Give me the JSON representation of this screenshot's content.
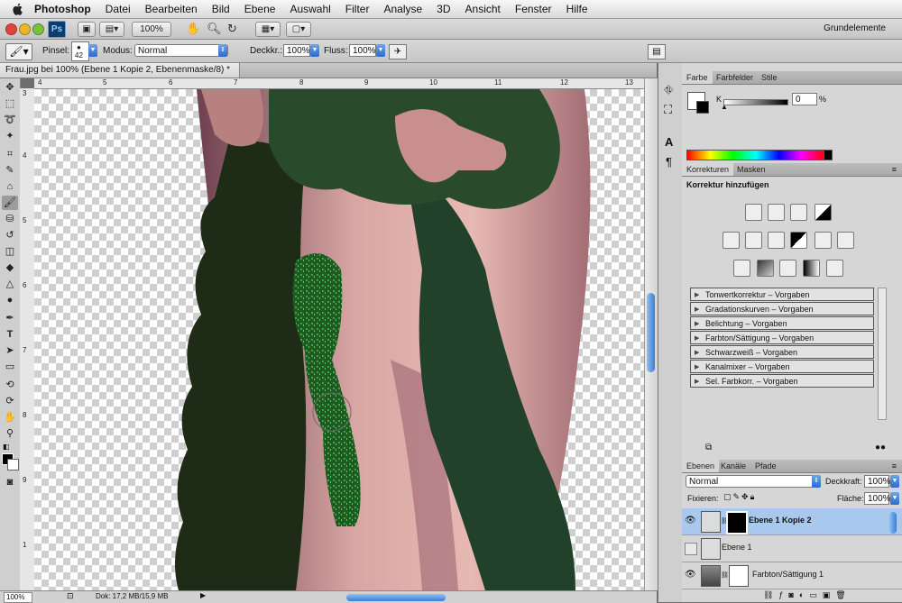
{
  "menubar": {
    "app": "Photoshop",
    "items": [
      "Datei",
      "Bearbeiten",
      "Bild",
      "Ebene",
      "Auswahl",
      "Filter",
      "Analyse",
      "3D",
      "Ansicht",
      "Fenster",
      "Hilfe"
    ]
  },
  "appbar": {
    "ps": "Ps",
    "zoom": "100%",
    "workspace": "Grundelemente"
  },
  "options": {
    "brush_label": "Pinsel:",
    "brush_size": "42",
    "mode_label": "Modus:",
    "mode_value": "Normal",
    "opacity_label": "Deckkr.:",
    "opacity_value": "100%",
    "flow_label": "Fluss:",
    "flow_value": "100%"
  },
  "document": {
    "tab_title": "Frau.jpg bei 100% (Ebene 1 Kopie 2, Ebenenmaske/8) *"
  },
  "ruler": {
    "top": [
      "4",
      "5",
      "6",
      "7",
      "8",
      "9",
      "10",
      "11",
      "12",
      "13"
    ],
    "left": [
      "3",
      "4",
      "5",
      "6",
      "7",
      "8",
      "9",
      "1"
    ]
  },
  "status": {
    "zoom": "100%",
    "doc": "Dok: 17,2 MB/15,9 MB"
  },
  "color_panel": {
    "tabs": [
      "Farbe",
      "Farbfelder",
      "Stile"
    ],
    "k_label": "K",
    "k_value": "0",
    "percent": "%"
  },
  "adjust_panel": {
    "tabs": [
      "Korrekturen",
      "Masken"
    ],
    "heading": "Korrektur hinzufügen",
    "presets": [
      "Tonwertkorrektur – Vorgaben",
      "Gradationskurven – Vorgaben",
      "Belichtung – Vorgaben",
      "Farbton/Sättigung – Vorgaben",
      "Schwarzweiß – Vorgaben",
      "Kanalmixer – Vorgaben",
      "Sel. Farbkorr. – Vorgaben"
    ]
  },
  "layers_panel": {
    "tabs": [
      "Ebenen",
      "Kanäle",
      "Pfade"
    ],
    "blend": "Normal",
    "opacity_label": "Deckkraft:",
    "opacity": "100%",
    "lock_label": "Fixieren:",
    "fill_label": "Fläche:",
    "fill": "100%",
    "layers": [
      {
        "name": "Ebene 1 Kopie 2",
        "selected": true
      },
      {
        "name": "Ebene 1",
        "selected": false
      },
      {
        "name": "Farbton/Sättigung 1",
        "selected": false
      }
    ]
  },
  "colors": {
    "accent": "#3a7fd6",
    "selection": "#a9c8ee"
  }
}
